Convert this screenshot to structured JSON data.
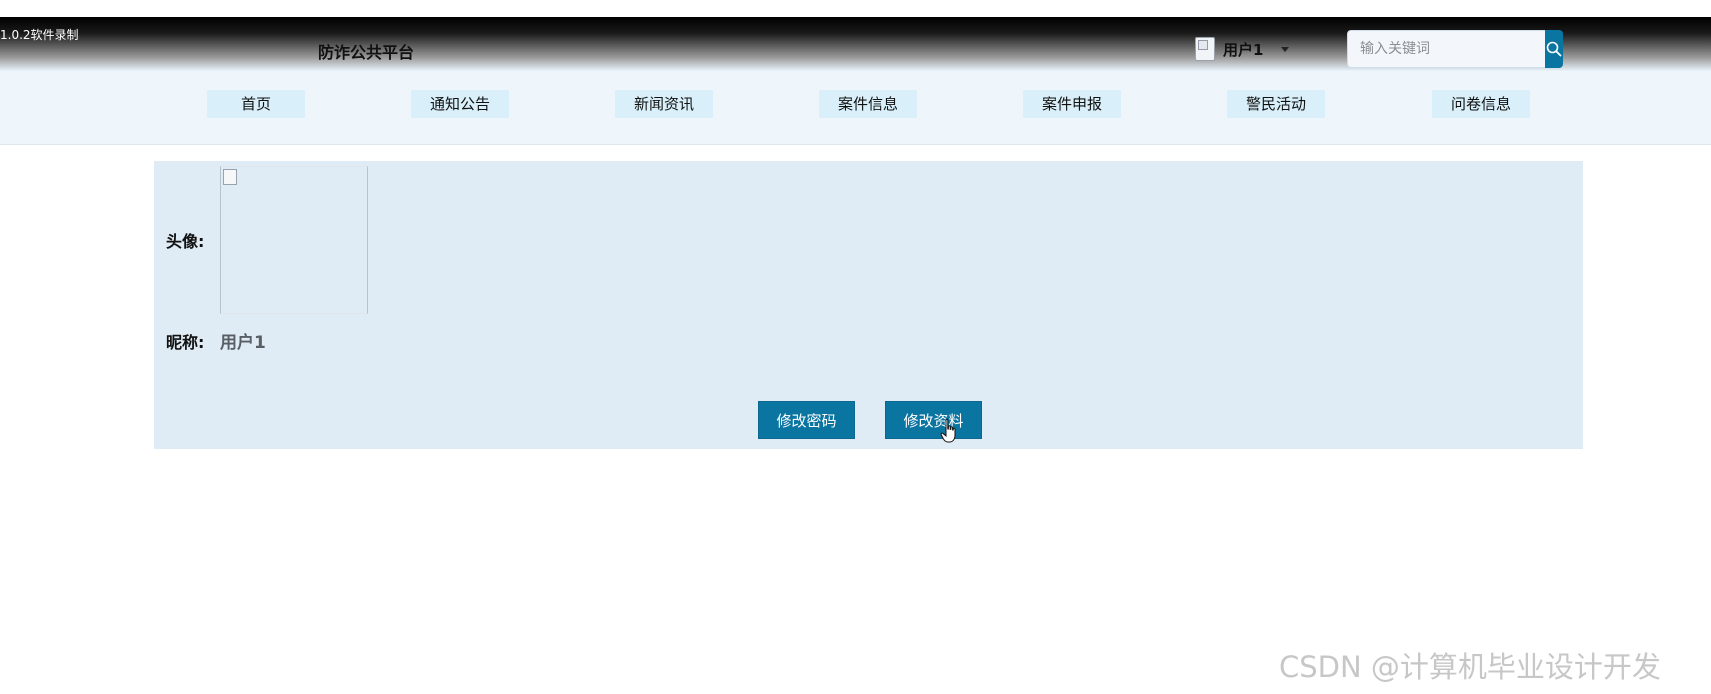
{
  "recorder": {
    "label": "1.0.2软件录制"
  },
  "header": {
    "site_title": "防诈公共平台",
    "user_name": "用户1",
    "search_placeholder": "输入关键词"
  },
  "nav": {
    "items": [
      {
        "label": "首页"
      },
      {
        "label": "通知公告"
      },
      {
        "label": "新闻资讯"
      },
      {
        "label": "案件信息"
      },
      {
        "label": "案件申报"
      },
      {
        "label": "警民活动"
      },
      {
        "label": "问卷信息"
      }
    ]
  },
  "profile": {
    "avatar_label": "头像:",
    "nickname_label": "昵称:",
    "nickname_value": "用户1",
    "change_password_label": "修改密码",
    "edit_profile_label": "修改资料"
  },
  "watermark": {
    "text": "CSDN @计算机毕业设计开发"
  },
  "colors": {
    "accent": "#0b75a2",
    "nav_item_bg": "#d9f0fa",
    "panel_bg": "#e0ecf5"
  }
}
